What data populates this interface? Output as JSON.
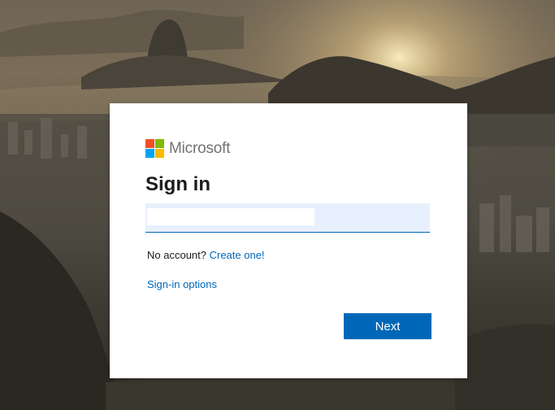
{
  "brand": {
    "name": "Microsoft",
    "logo_colors": [
      "#f25022",
      "#7fba00",
      "#00a4ef",
      "#ffb900"
    ]
  },
  "signin": {
    "title": "Sign in",
    "email_value": "",
    "no_account_text": "No account?",
    "create_link": "Create one!",
    "options_link": "Sign-in options",
    "next_button": "Next"
  },
  "colors": {
    "accent": "#0067b8",
    "field_background": "#e8f0fe",
    "card_background": "#ffffff"
  }
}
